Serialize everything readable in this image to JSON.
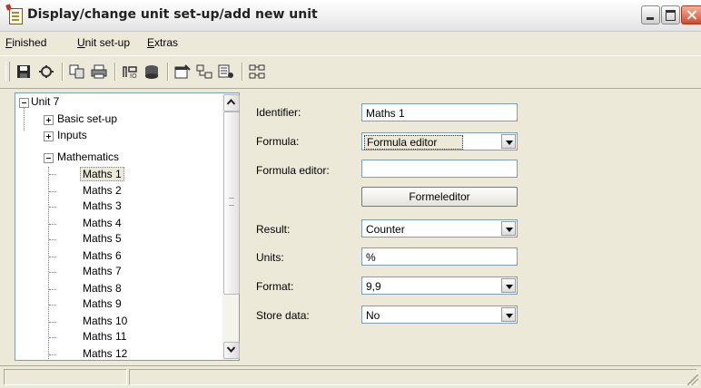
{
  "window": {
    "title": "Display/change unit set-up/add new unit"
  },
  "menu": [
    {
      "prefix": "",
      "accel": "F",
      "rest": "inished"
    },
    {
      "prefix": "",
      "accel": "U",
      "rest": "nit set-up"
    },
    {
      "prefix": "",
      "accel": "E",
      "rest": "xtras"
    }
  ],
  "toolbar": {
    "icons": [
      "save-icon",
      "unit-icon",
      "copy-icon",
      "print-icon",
      "io-icon",
      "database-icon",
      "properties-icon",
      "connect-icon",
      "list-icon",
      "network-icon"
    ]
  },
  "tree": {
    "root": "Unit 7",
    "groups": [
      "Basic set-up",
      "Inputs",
      "Mathematics"
    ],
    "items": [
      "Maths 1",
      "Maths 2",
      "Maths 3",
      "Maths 4",
      "Maths 5",
      "Maths 6",
      "Maths 7",
      "Maths 8",
      "Maths 9",
      "Maths 10",
      "Maths 11",
      "Maths 12"
    ],
    "selected": "Maths 1"
  },
  "form": {
    "identifier_label": "Identifier:",
    "identifier_value": "Maths 1",
    "formula_label": "Formula:",
    "formula_value": "Formula editor",
    "formula_editor_label": "Formula editor:",
    "formula_editor_value": "",
    "formeleditor_button": "Formeleditor",
    "result_label": "Result:",
    "result_value": "Counter",
    "units_label": "Units:",
    "units_value": "%",
    "format_label": "Format:",
    "format_value": "9,9",
    "store_label": "Store data:",
    "store_value": "No"
  }
}
